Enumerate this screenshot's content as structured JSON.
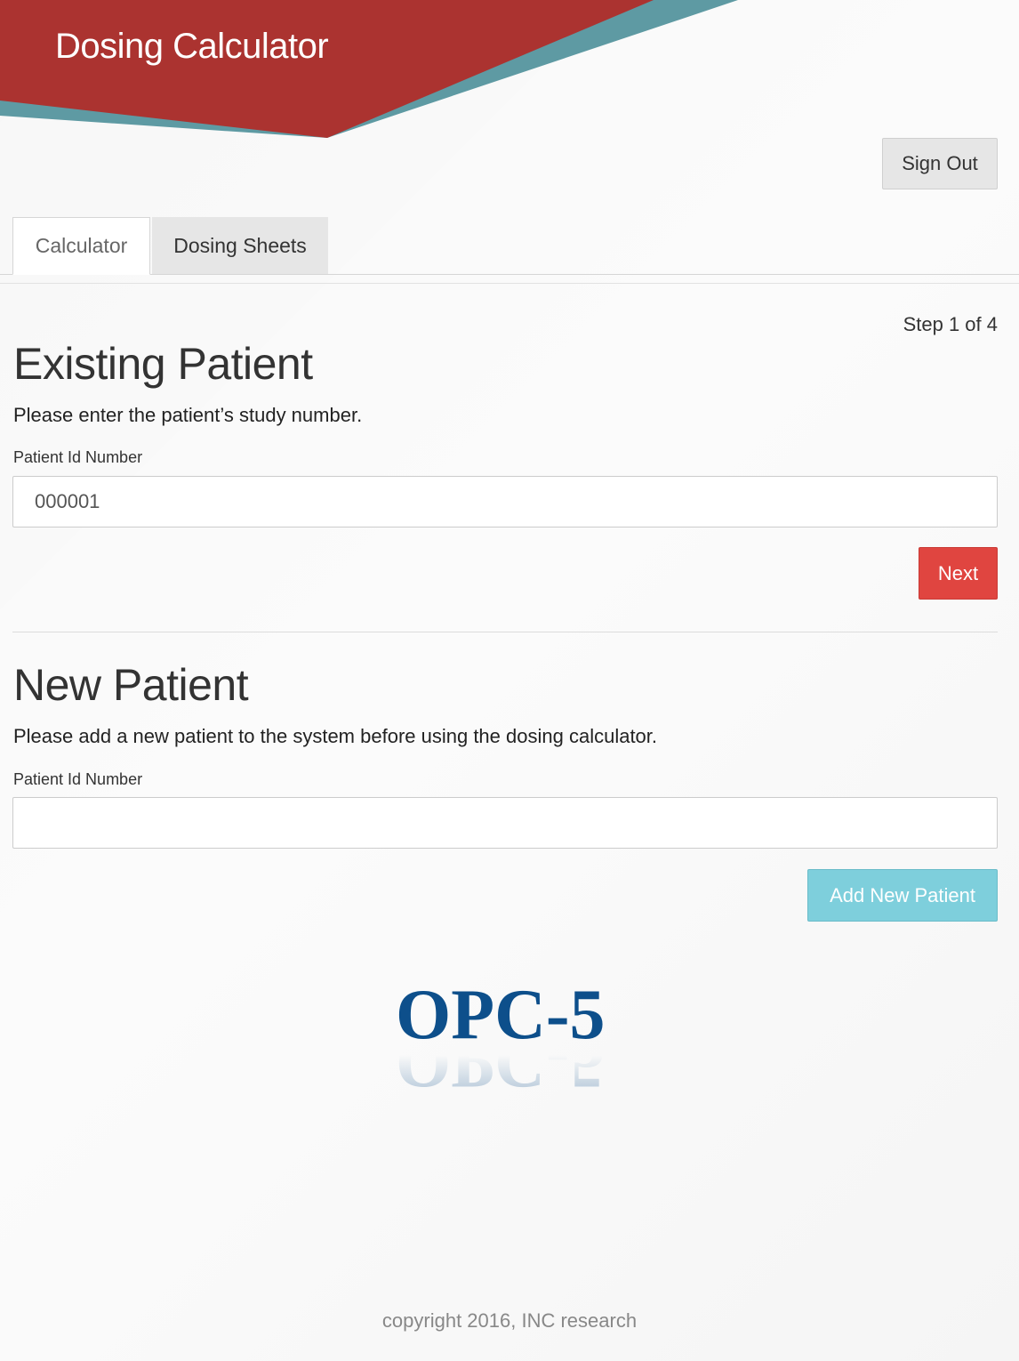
{
  "header": {
    "app_title": "Dosing Calculator",
    "brand_red": "#ab3330",
    "brand_teal": "#5e9aa3"
  },
  "account": {
    "sign_out_label": "Sign Out"
  },
  "tabs": [
    {
      "label": "Calculator",
      "active": true
    },
    {
      "label": "Dosing Sheets",
      "active": false
    }
  ],
  "wizard": {
    "step_text": "Step 1 of 4"
  },
  "existing_patient": {
    "heading": "Existing Patient",
    "instruction": "Please enter the patient’s study number.",
    "field_label": "Patient Id Number",
    "field_value": "000001",
    "next_label": "Next"
  },
  "new_patient": {
    "heading": "New Patient",
    "instruction": "Please add a new patient to the system before using the dosing calculator.",
    "field_label": "Patient Id Number",
    "field_value": "",
    "add_label": "Add New Patient"
  },
  "logo": {
    "text": "OPC-5",
    "color": "#0d4f8b"
  },
  "footer": {
    "copyright": "copyright 2016, INC research"
  }
}
